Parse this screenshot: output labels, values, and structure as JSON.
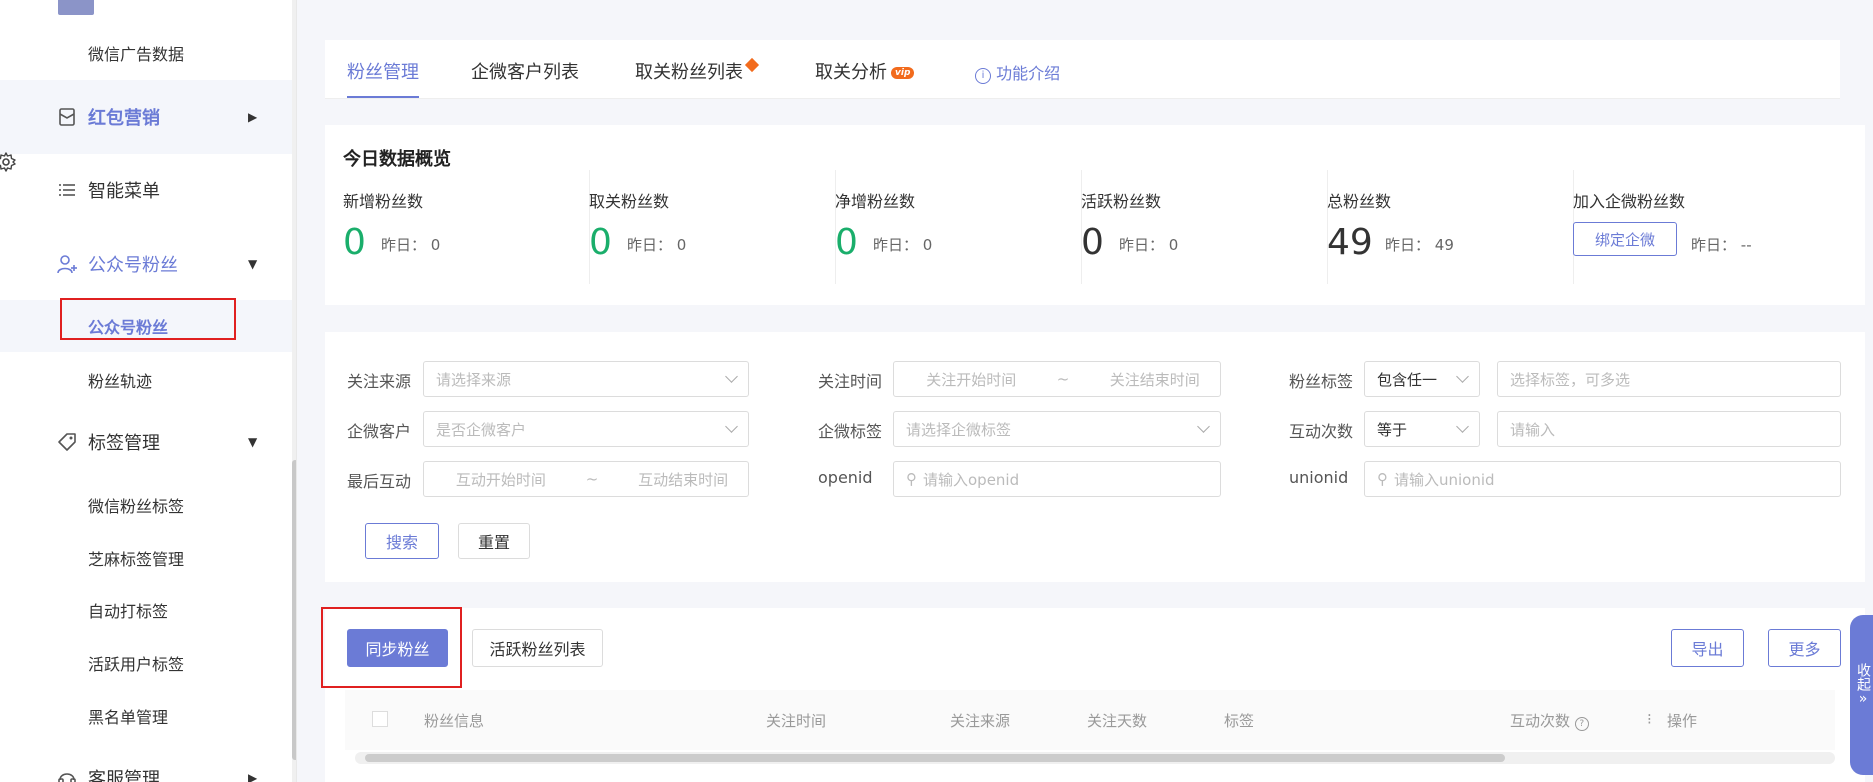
{
  "sidebar": {
    "items": [
      {
        "label": "微信广告数据"
      },
      {
        "label": "红包营销",
        "icon": "red-packet-icon"
      },
      {
        "label": "智能菜单",
        "icon": "list-icon"
      },
      {
        "label": "公众号粉丝",
        "icon": "user-add-icon"
      },
      {
        "label": "公众号粉丝"
      },
      {
        "label": "粉丝轨迹"
      },
      {
        "label": "标签管理",
        "icon": "tag-icon"
      },
      {
        "label": "微信粉丝标签"
      },
      {
        "label": "芝麻标签管理"
      },
      {
        "label": "自动打标签"
      },
      {
        "label": "活跃用户标签"
      },
      {
        "label": "黑名单管理"
      },
      {
        "label": "客服管理",
        "icon": "headset-icon"
      }
    ]
  },
  "tabs": [
    {
      "label": "粉丝管理"
    },
    {
      "label": "企微客户列表"
    },
    {
      "label": "取关粉丝列表"
    },
    {
      "label": "取关分析",
      "badge": "vip"
    },
    {
      "label": "功能介绍"
    }
  ],
  "overview": {
    "title": "今日数据概览",
    "stats": [
      {
        "label": "新增粉丝数",
        "value": "0",
        "yesterday_label": "昨日：",
        "yesterday": "0"
      },
      {
        "label": "取关粉丝数",
        "value": "0",
        "yesterday_label": "昨日：",
        "yesterday": "0"
      },
      {
        "label": "净增粉丝数",
        "value": "0",
        "yesterday_label": "昨日：",
        "yesterday": "0"
      },
      {
        "label": "活跃粉丝数",
        "value": "0",
        "yesterday_label": "昨日：",
        "yesterday": "0"
      },
      {
        "label": "总粉丝数",
        "value": "49",
        "yesterday_label": "昨日：",
        "yesterday": "49"
      },
      {
        "label": "加入企微粉丝数",
        "button": "绑定企微",
        "yesterday_label": "昨日：",
        "yesterday": "--"
      }
    ]
  },
  "filters": {
    "source_label": "关注来源",
    "source_placeholder": "请选择来源",
    "time_label": "关注时间",
    "time_start": "关注开始时间",
    "time_sep": "~",
    "time_end": "关注结束时间",
    "tag_label": "粉丝标签",
    "tag_mode": "包含任一",
    "tag_placeholder": "选择标签，可多选",
    "wecom_label": "企微客户",
    "wecom_placeholder": "是否企微客户",
    "wecom_tag_label": "企微标签",
    "wecom_tag_placeholder": "请选择企微标签",
    "interact_count_label": "互动次数",
    "interact_op": "等于",
    "interact_placeholder": "请输入",
    "last_interact_label": "最后互动",
    "last_start": "互动开始时间",
    "last_sep": "~",
    "last_end": "互动结束时间",
    "openid_label": "openid",
    "openid_placeholder": "请输入openid",
    "unionid_label": "unionid",
    "unionid_placeholder": "请输入unionid",
    "search_button": "搜索",
    "reset_button": "重置"
  },
  "toolbar": {
    "sync_button": "同步粉丝",
    "active_list_button": "活跃粉丝列表",
    "export_button": "导出",
    "more_button": "更多"
  },
  "table": {
    "columns": [
      "粉丝信息",
      "关注时间",
      "关注来源",
      "关注天数",
      "标签",
      "互动次数",
      "操作"
    ]
  },
  "collapse": {
    "label": "收起"
  }
}
